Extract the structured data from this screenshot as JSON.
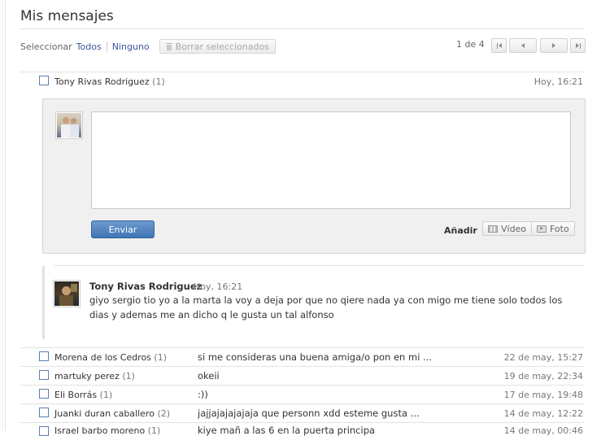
{
  "page": {
    "title": "Mis mensajes"
  },
  "selection": {
    "label": "Seleccionar",
    "all": "Todos",
    "none": "Ninguno",
    "delete_selected": "Borrar seleccionados"
  },
  "pagination": {
    "text": "1 de 4"
  },
  "open_conversation": {
    "name": "Tony Rivas Rodriguez",
    "count": "(1)",
    "date": "Hoy, 16:21",
    "compose": {
      "placeholder": "",
      "send_label": "Enviar",
      "add_label": "Añadir",
      "video_label": "Vídeo",
      "photo_label": "Foto"
    },
    "message": {
      "author": "Tony Rivas Rodriguez",
      "time": "Hoy, 16:21",
      "body": "giyo sergio tio yo a la marta la voy a deja por que no qiere nada ya con migo me tiene solo todos los dias y ademas me an dicho q le gusta un tal alfonso"
    }
  },
  "conversations": [
    {
      "name": "Morena de los Cedros",
      "count": "(1)",
      "snippet": "si me consideras una buena amiga/o pon en mi ...",
      "date": "22 de may, 15:27"
    },
    {
      "name": "martuky perez",
      "count": "(1)",
      "snippet": "okeii",
      "date": "19 de may, 22:34"
    },
    {
      "name": "Eli Borrás",
      "count": "(1)",
      "snippet": ":))",
      "date": "17 de may, 19:48"
    },
    {
      "name": "Juanki duran caballero",
      "count": "(2)",
      "snippet": "jajjajajajajaja que personn xdd esteme gusta ...",
      "date": "14 de may, 12:22"
    },
    {
      "name": "Israel barbo moreno",
      "count": "(1)",
      "snippet": "kiye mañ a las 6 en la puerta principa",
      "date": "14 de may, 00:46"
    }
  ]
}
